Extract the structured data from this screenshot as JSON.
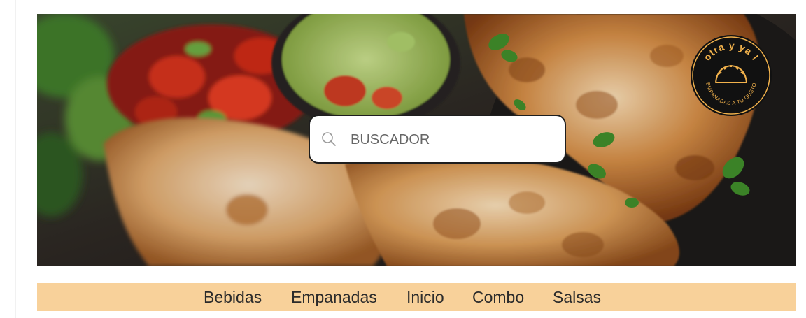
{
  "search": {
    "placeholder": "BUSCADOR"
  },
  "logo": {
    "top_text": "otra y ya !",
    "bottom_text": "EMPANADAS A TU GUSTO"
  },
  "nav": {
    "items": [
      {
        "label": "Bebidas"
      },
      {
        "label": "Empanadas"
      },
      {
        "label": "Inicio"
      },
      {
        "label": "Combo"
      },
      {
        "label": "Salsas"
      }
    ]
  },
  "colors": {
    "nav_background": "#f8d19a",
    "logo_accent": "#f2b24c",
    "logo_background": "#111111"
  }
}
